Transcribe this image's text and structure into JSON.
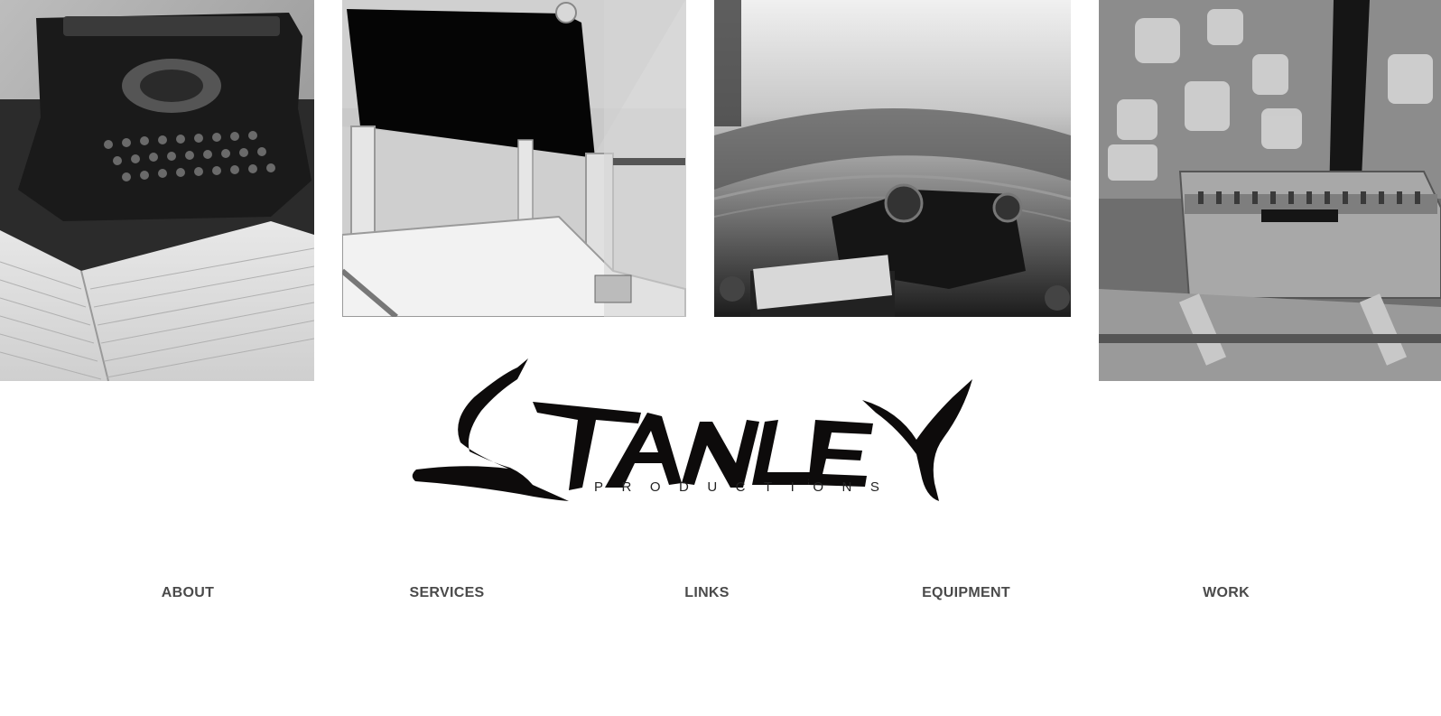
{
  "photos": [
    {
      "name": "typewriter-photo",
      "alt": "Typewriter and ledger"
    },
    {
      "name": "directors-chair-photo",
      "alt": "Director's chair"
    },
    {
      "name": "film-reel-photo",
      "alt": "Film editing reel"
    },
    {
      "name": "film-splicer-photo",
      "alt": "Film splicer"
    }
  ],
  "logo": {
    "word": "STANLEY",
    "sub": "PRODUCTIONS"
  },
  "nav": [
    {
      "label": "ABOUT"
    },
    {
      "label": "SERVICES"
    },
    {
      "label": "LINKS"
    },
    {
      "label": "EQUIPMENT"
    },
    {
      "label": "WORK"
    }
  ]
}
